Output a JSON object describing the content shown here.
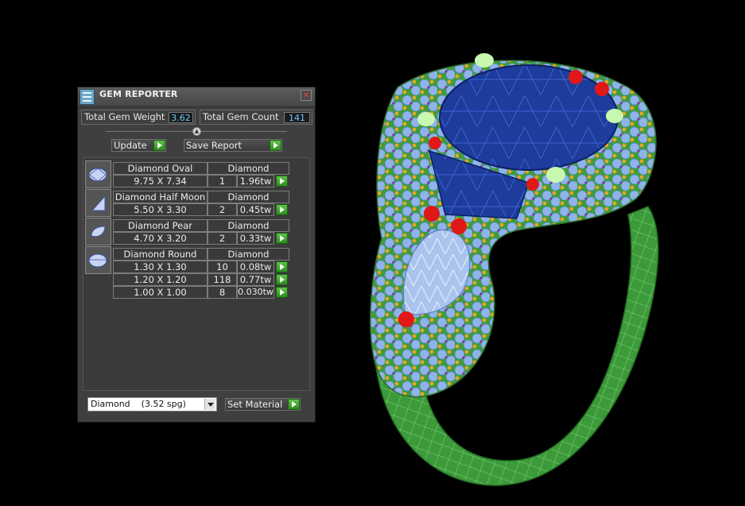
{
  "window": {
    "title": "GEM REPORTER",
    "icon": "app-icon",
    "close_icon": "close-icon"
  },
  "totals": {
    "weight_label": "Total Gem Weight",
    "weight_value": "3.62",
    "count_label": "Total Gem Count",
    "count_value": "141"
  },
  "toolbar": {
    "update_label": "Update",
    "save_label": "Save Report"
  },
  "gems": [
    {
      "name": "Diamond Oval",
      "material": "Diamond",
      "icon": "oval-gem-icon",
      "rows": [
        {
          "size": "9.75 X 7.34",
          "count": "1",
          "weight": "1.96tw"
        }
      ]
    },
    {
      "name": "Diamond Half Moon",
      "material": "Diamond",
      "icon": "half-moon-gem-icon",
      "rows": [
        {
          "size": "5.50 X 3.30",
          "count": "2",
          "weight": "0.45tw"
        }
      ]
    },
    {
      "name": "Diamond Pear",
      "material": "Diamond",
      "icon": "pear-gem-icon",
      "rows": [
        {
          "size": "4.70 X 3.20",
          "count": "2",
          "weight": "0.33tw"
        }
      ]
    },
    {
      "name": "Diamond Round",
      "material": "Diamond",
      "icon": "round-gem-icon",
      "rows": [
        {
          "size": "1.30 X 1.30",
          "count": "10",
          "weight": "0.08tw"
        },
        {
          "size": "1.20 X 1.20",
          "count": "118",
          "weight": "0.77tw"
        },
        {
          "size": "1.00 X 1.00",
          "count": "8",
          "weight": "0.030tw"
        }
      ]
    }
  ],
  "material_select": {
    "value": "Diamond    (3.52 spg)",
    "button_label": "Set Material"
  },
  "colors": {
    "panel_bg": "#3f3f3f",
    "value_text": "#6cc8ff",
    "go_button": "#3fa42e",
    "ring_band": "#3c9a3a",
    "center_stone": "#1f3fa0",
    "accent_stones": "#8fb4e8",
    "prongs_red": "#e01818",
    "prongs_light": "#c8f7b0"
  }
}
